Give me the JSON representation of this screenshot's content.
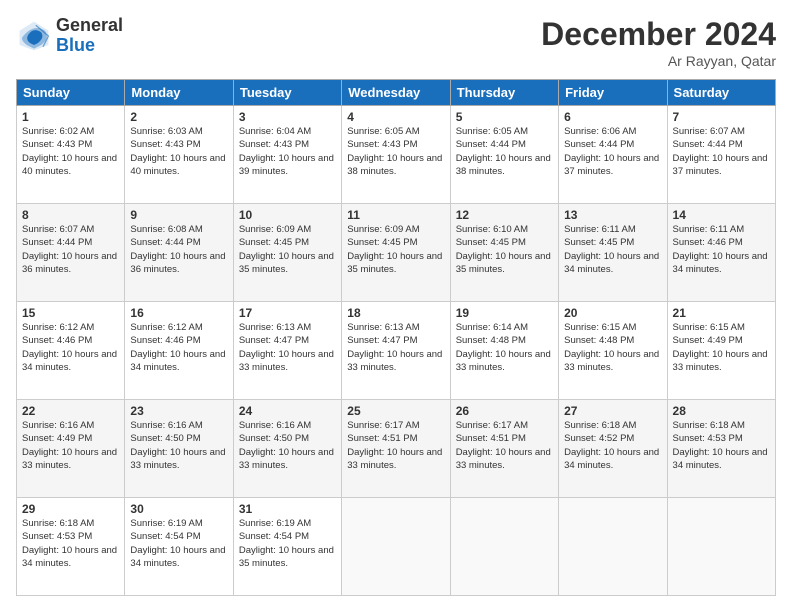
{
  "header": {
    "logo_general": "General",
    "logo_blue": "Blue",
    "month_title": "December 2024",
    "location": "Ar Rayyan, Qatar"
  },
  "days_of_week": [
    "Sunday",
    "Monday",
    "Tuesday",
    "Wednesday",
    "Thursday",
    "Friday",
    "Saturday"
  ],
  "weeks": [
    [
      {
        "day": "1",
        "sunrise": "6:02 AM",
        "sunset": "4:43 PM",
        "daylight": "10 hours and 40 minutes."
      },
      {
        "day": "2",
        "sunrise": "6:03 AM",
        "sunset": "4:43 PM",
        "daylight": "10 hours and 40 minutes."
      },
      {
        "day": "3",
        "sunrise": "6:04 AM",
        "sunset": "4:43 PM",
        "daylight": "10 hours and 39 minutes."
      },
      {
        "day": "4",
        "sunrise": "6:05 AM",
        "sunset": "4:43 PM",
        "daylight": "10 hours and 38 minutes."
      },
      {
        "day": "5",
        "sunrise": "6:05 AM",
        "sunset": "4:44 PM",
        "daylight": "10 hours and 38 minutes."
      },
      {
        "day": "6",
        "sunrise": "6:06 AM",
        "sunset": "4:44 PM",
        "daylight": "10 hours and 37 minutes."
      },
      {
        "day": "7",
        "sunrise": "6:07 AM",
        "sunset": "4:44 PM",
        "daylight": "10 hours and 37 minutes."
      }
    ],
    [
      {
        "day": "8",
        "sunrise": "6:07 AM",
        "sunset": "4:44 PM",
        "daylight": "10 hours and 36 minutes."
      },
      {
        "day": "9",
        "sunrise": "6:08 AM",
        "sunset": "4:44 PM",
        "daylight": "10 hours and 36 minutes."
      },
      {
        "day": "10",
        "sunrise": "6:09 AM",
        "sunset": "4:45 PM",
        "daylight": "10 hours and 35 minutes."
      },
      {
        "day": "11",
        "sunrise": "6:09 AM",
        "sunset": "4:45 PM",
        "daylight": "10 hours and 35 minutes."
      },
      {
        "day": "12",
        "sunrise": "6:10 AM",
        "sunset": "4:45 PM",
        "daylight": "10 hours and 35 minutes."
      },
      {
        "day": "13",
        "sunrise": "6:11 AM",
        "sunset": "4:45 PM",
        "daylight": "10 hours and 34 minutes."
      },
      {
        "day": "14",
        "sunrise": "6:11 AM",
        "sunset": "4:46 PM",
        "daylight": "10 hours and 34 minutes."
      }
    ],
    [
      {
        "day": "15",
        "sunrise": "6:12 AM",
        "sunset": "4:46 PM",
        "daylight": "10 hours and 34 minutes."
      },
      {
        "day": "16",
        "sunrise": "6:12 AM",
        "sunset": "4:46 PM",
        "daylight": "10 hours and 34 minutes."
      },
      {
        "day": "17",
        "sunrise": "6:13 AM",
        "sunset": "4:47 PM",
        "daylight": "10 hours and 33 minutes."
      },
      {
        "day": "18",
        "sunrise": "6:13 AM",
        "sunset": "4:47 PM",
        "daylight": "10 hours and 33 minutes."
      },
      {
        "day": "19",
        "sunrise": "6:14 AM",
        "sunset": "4:48 PM",
        "daylight": "10 hours and 33 minutes."
      },
      {
        "day": "20",
        "sunrise": "6:15 AM",
        "sunset": "4:48 PM",
        "daylight": "10 hours and 33 minutes."
      },
      {
        "day": "21",
        "sunrise": "6:15 AM",
        "sunset": "4:49 PM",
        "daylight": "10 hours and 33 minutes."
      }
    ],
    [
      {
        "day": "22",
        "sunrise": "6:16 AM",
        "sunset": "4:49 PM",
        "daylight": "10 hours and 33 minutes."
      },
      {
        "day": "23",
        "sunrise": "6:16 AM",
        "sunset": "4:50 PM",
        "daylight": "10 hours and 33 minutes."
      },
      {
        "day": "24",
        "sunrise": "6:16 AM",
        "sunset": "4:50 PM",
        "daylight": "10 hours and 33 minutes."
      },
      {
        "day": "25",
        "sunrise": "6:17 AM",
        "sunset": "4:51 PM",
        "daylight": "10 hours and 33 minutes."
      },
      {
        "day": "26",
        "sunrise": "6:17 AM",
        "sunset": "4:51 PM",
        "daylight": "10 hours and 33 minutes."
      },
      {
        "day": "27",
        "sunrise": "6:18 AM",
        "sunset": "4:52 PM",
        "daylight": "10 hours and 34 minutes."
      },
      {
        "day": "28",
        "sunrise": "6:18 AM",
        "sunset": "4:53 PM",
        "daylight": "10 hours and 34 minutes."
      }
    ],
    [
      {
        "day": "29",
        "sunrise": "6:18 AM",
        "sunset": "4:53 PM",
        "daylight": "10 hours and 34 minutes."
      },
      {
        "day": "30",
        "sunrise": "6:19 AM",
        "sunset": "4:54 PM",
        "daylight": "10 hours and 34 minutes."
      },
      {
        "day": "31",
        "sunrise": "6:19 AM",
        "sunset": "4:54 PM",
        "daylight": "10 hours and 35 minutes."
      },
      null,
      null,
      null,
      null
    ]
  ]
}
